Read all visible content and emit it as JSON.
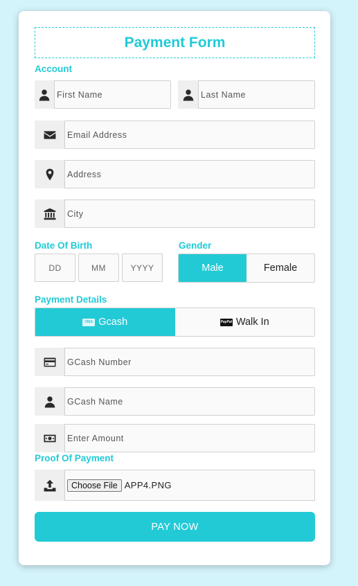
{
  "form": {
    "title": "Payment Form",
    "account_label": "Account",
    "first_name_placeholder": "First Name",
    "last_name_placeholder": "Last Name",
    "email_placeholder": "Email Address",
    "address_placeholder": "Address",
    "city_placeholder": "City",
    "dob_label": "Date Of Birth",
    "dob_day_placeholder": "DD",
    "dob_month_placeholder": "MM",
    "dob_year_placeholder": "YYYY",
    "gender_label": "Gender",
    "gender_options": [
      "Male",
      "Female"
    ],
    "gender_selected": "Male",
    "payment_details_label": "Payment Details",
    "payment_methods": [
      "Gcash",
      "Walk In"
    ],
    "payment_selected": "Gcash",
    "gcash_number_placeholder": "GCash Number",
    "gcash_name_placeholder": "GCash Name",
    "amount_placeholder": "Enter Amount",
    "proof_label": "Proof Of Payment",
    "choose_file_label": "Choose File",
    "file_name": "APP4.PNG",
    "submit_label": "PAY NOW"
  },
  "colors": {
    "accent": "#22cad6",
    "background": "#d4f4fb"
  },
  "icons": {
    "first_name": "user-icon",
    "last_name": "user-icon",
    "email": "envelope-icon",
    "address": "map-marker-icon",
    "city": "bank-icon",
    "gcash_number": "credit-card-icon",
    "gcash_name": "user-icon",
    "amount": "money-bill-icon",
    "proof": "upload-icon"
  }
}
